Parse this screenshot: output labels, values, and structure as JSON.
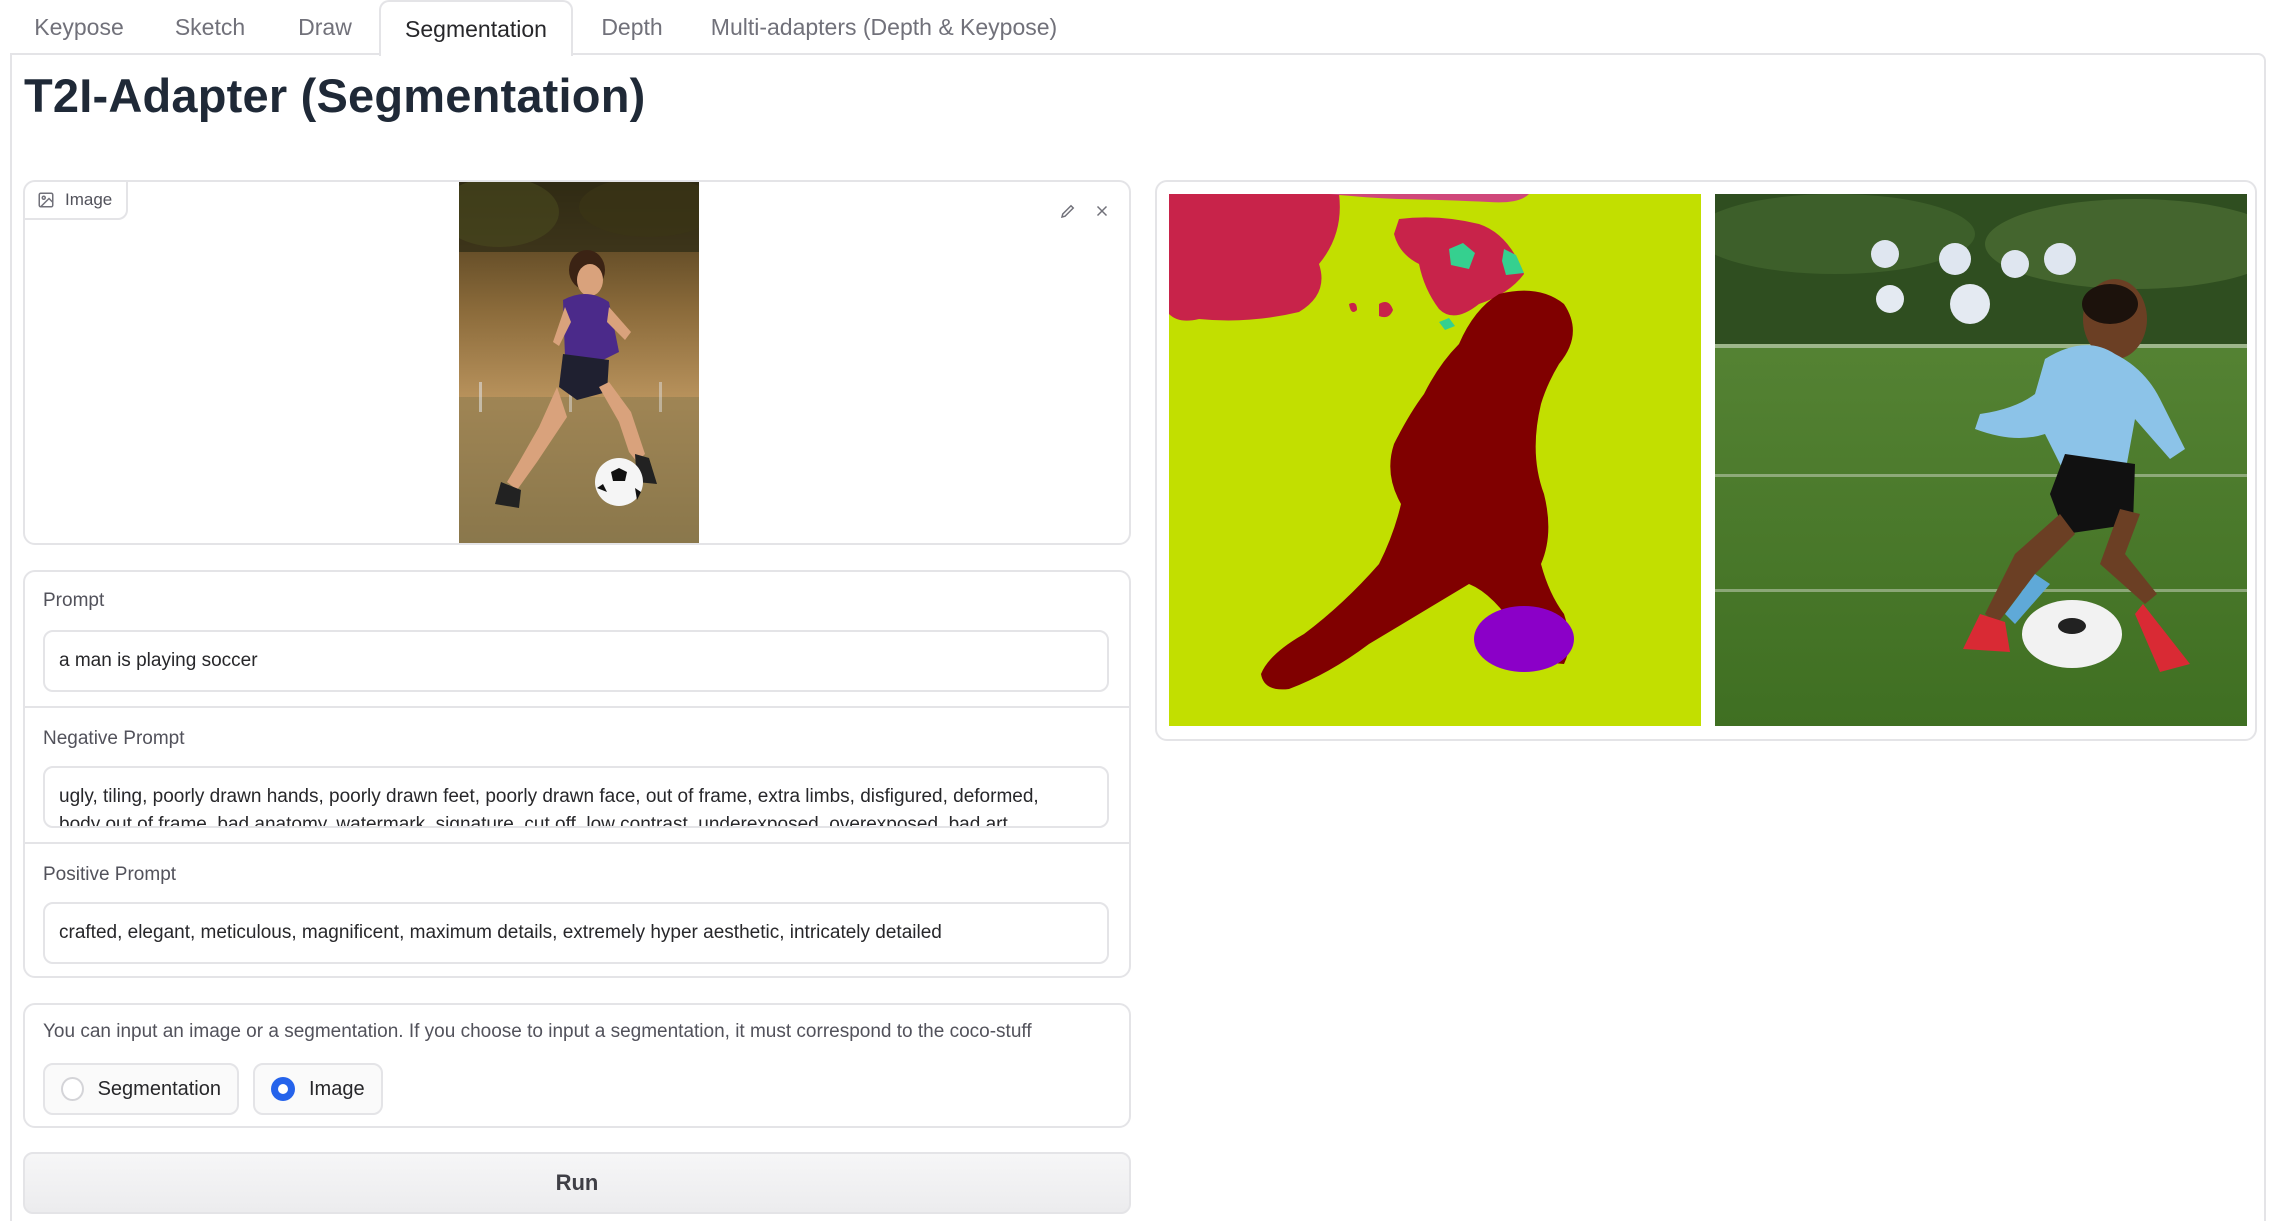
{
  "tabs": [
    {
      "label": "Keypose"
    },
    {
      "label": "Sketch"
    },
    {
      "label": "Draw"
    },
    {
      "label": "Segmentation"
    },
    {
      "label": "Depth"
    },
    {
      "label": "Multi-adapters (Depth & Keypose)"
    }
  ],
  "active_tab": "Segmentation",
  "title": "T2I-Adapter (Segmentation)",
  "image_input": {
    "label": "Image",
    "edit_icon": "pencil-icon",
    "clear_icon": "close-icon",
    "icon": "image-icon"
  },
  "prompt": {
    "label": "Prompt",
    "value": "a man is playing soccer"
  },
  "negative_prompt": {
    "label": "Negative Prompt",
    "line1": "ugly, tiling, poorly drawn hands, poorly drawn feet, poorly drawn face, out of frame, extra limbs, disfigured, deformed,",
    "line2": "body out of frame, bad anatomy, watermark, signature, cut off, low contrast, underexposed, overexposed, bad art"
  },
  "positive_prompt": {
    "label": "Positive Prompt",
    "value": "crafted, elegant, meticulous, magnificent, maximum details, extremely hyper aesthetic, intricately detailed"
  },
  "input_type": {
    "info": "You can input an image or a segmentation. If you choose to input a segmentation, it must correspond to the coco-stuff",
    "options": [
      "Segmentation",
      "Image"
    ],
    "selected": "Image"
  },
  "run_button": {
    "label": "Run"
  },
  "colors": {
    "accent": "#2563eb",
    "seg_background": "#c2df00",
    "seg_person": "#800000",
    "seg_ball": "#8b00c8",
    "seg_trees": "#c8234a"
  }
}
